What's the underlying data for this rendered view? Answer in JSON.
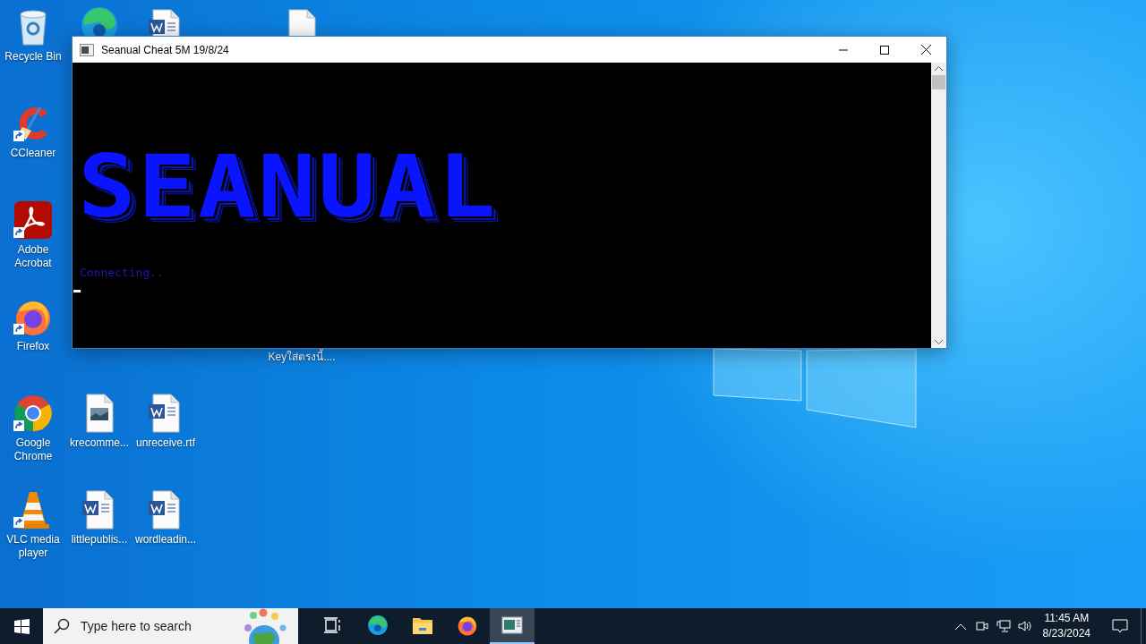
{
  "desktop": {
    "icons": [
      {
        "kind": "recycle-bin",
        "label": "Recycle Bin",
        "shortcut": false
      },
      {
        "kind": "edge"
      },
      {
        "kind": "word"
      },
      {
        "kind": "blank-file"
      },
      {
        "kind": "ccleaner",
        "label": "CCleaner",
        "shortcut": true
      },
      {
        "kind": "acrobat",
        "label": "Adobe Acrobat",
        "shortcut": true
      },
      {
        "kind": "firefox",
        "label": "Firefox",
        "shortcut": true
      },
      {
        "kind": "hidden",
        "label": "Keyใส่ตรงนี้....",
        "shortcut": false
      },
      {
        "kind": "chrome",
        "label": "Google Chrome",
        "shortcut": true
      },
      {
        "kind": "image-file",
        "label": "krecomme...",
        "shortcut": false
      },
      {
        "kind": "word",
        "label": "unreceive.rtf",
        "shortcut": false
      },
      {
        "kind": "vlc",
        "label": "VLC media player",
        "shortcut": true
      },
      {
        "kind": "word",
        "label": "littlepublis...",
        "shortcut": false
      },
      {
        "kind": "word",
        "label": "wordleadin...",
        "shortcut": false
      }
    ]
  },
  "window": {
    "title": "Seanual Cheat 5M 19/8/24",
    "console": {
      "banner": "SEANUAL",
      "lines": [
        "Connecting.."
      ]
    }
  },
  "taskbar": {
    "search": {
      "placeholder": "Type here to search"
    },
    "apps": [
      {
        "kind": "task-view",
        "selected": false
      },
      {
        "kind": "edge",
        "selected": false
      },
      {
        "kind": "explorer",
        "selected": false
      },
      {
        "kind": "firefox",
        "selected": false
      },
      {
        "kind": "console",
        "selected": true
      }
    ],
    "clock": {
      "time": "11:45 AM",
      "date": "8/23/2024"
    }
  }
}
